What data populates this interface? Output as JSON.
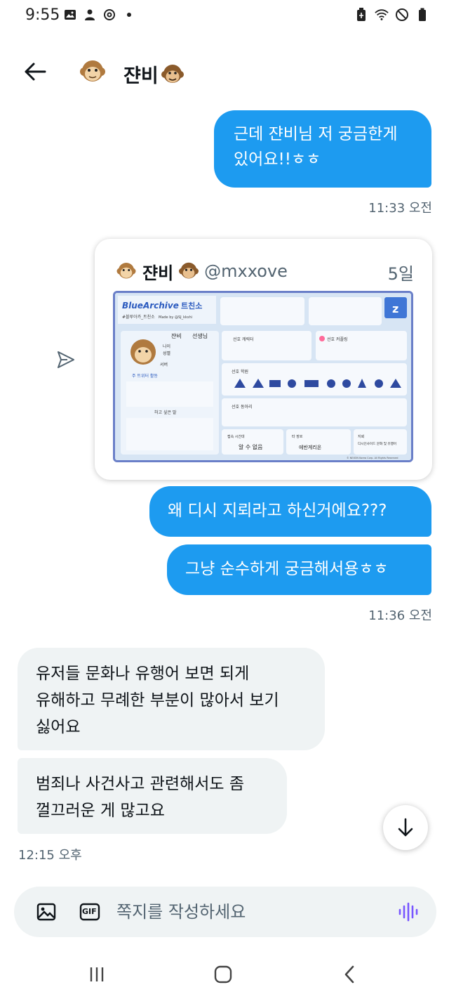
{
  "status_bar": {
    "time": "9:55"
  },
  "header": {
    "contact_name": "쟌비",
    "back_icon": "arrow-left-icon"
  },
  "messages": {
    "m1": "근데 쟌비님 저 궁금한게 있어요!!ㅎㅎ",
    "m1_line1": "근데 쟌비님 저 궁금한게",
    "m1_line2": "있어요!!ㅎㅎ",
    "ts1": "11:33 오전",
    "m2": "왜 디시 지뢰라고 하신거에요???",
    "m3": "그냥 순수하게 궁금해서용ㅎㅎ",
    "ts2": "11:36 오전",
    "m4_line1": "유저들 문화나 유행어 보면 되게",
    "m4_line2": "유해하고 무례한 부분이 많아서 보기",
    "m4_line3": "싫어요",
    "m5_line1": "범죄나 사건사고 관련해서도 좀",
    "m5_line2": "껄끄러운 게 많고요",
    "ts3": "12:15 오후"
  },
  "quoted_tweet": {
    "name": "쟌비",
    "handle": "@mxxove",
    "time": "5일",
    "image_text": {
      "logo": "BlueArchive",
      "title": "트친소",
      "hashtag": "#블루아카_트친소",
      "made_by": "Made by @SJ_kkshi",
      "name_label": "쟌비",
      "teacher": "선생님",
      "age": "나이",
      "gender": "성별",
      "server": "서버",
      "section_main": "주 트위터 활동",
      "unfollow": "하고 싶은 말",
      "fav_char": "선호 캐릭터",
      "fav_ship": "선호 커플링",
      "fav_school": "선호 학원",
      "fav_club": "선호 동아리",
      "contact_time_label": "접속 시간대",
      "contact_time": "알 수 없음",
      "genre_label": "타 장르",
      "genre": "에반게리온",
      "mine_label": "지뢰",
      "mine": "디시인사이드 문화 및 유행어",
      "copyright": "© NEXON Korea Corp. All Rights Reserved"
    }
  },
  "composer": {
    "placeholder": "쪽지를 작성하세요",
    "gif_label": "GIF"
  },
  "colors": {
    "bubble_out": "#1d9bf0",
    "bubble_in": "#eff3f4",
    "accent_voice": "#7856ff"
  }
}
